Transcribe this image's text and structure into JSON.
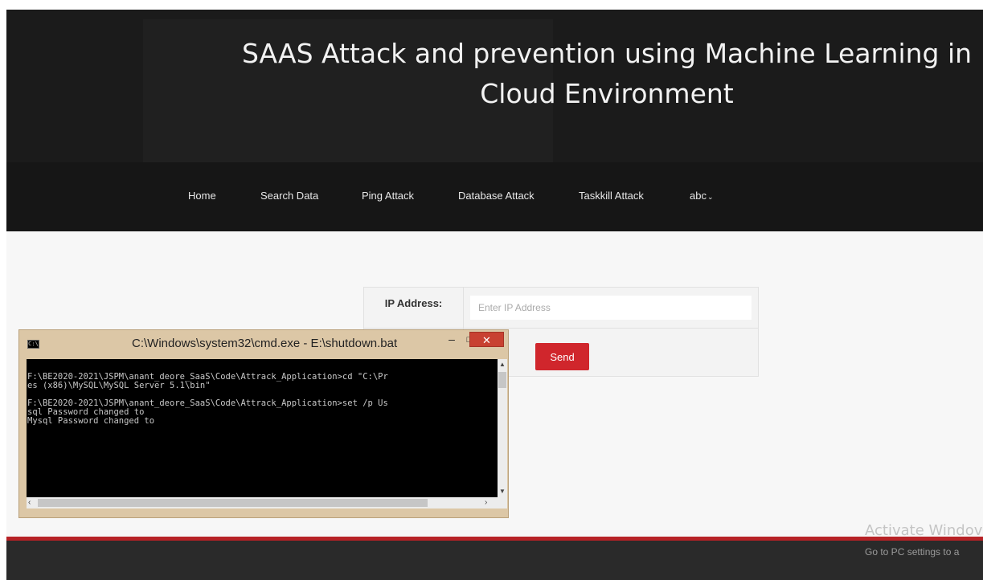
{
  "header": {
    "title": "SAAS Attack and prevention using Machine Learning in Cloud Environment"
  },
  "nav": {
    "items": [
      {
        "label": "Home"
      },
      {
        "label": "Search Data"
      },
      {
        "label": "Ping Attack"
      },
      {
        "label": "Database Attack"
      },
      {
        "label": "Taskkill Attack"
      },
      {
        "label": "abc"
      }
    ],
    "dropdown_icon": "chevron-down-icon"
  },
  "form": {
    "ip_label": "IP Address:",
    "ip_placeholder": "Enter IP Address",
    "send_label": "Send"
  },
  "cmd_window": {
    "title": "C:\\Windows\\system32\\cmd.exe - E:\\shutdown.bat",
    "lines": [
      "F:\\BE2020-2021\\JSPM\\anant_deore_SaaS\\Code\\Attrack_Application>cd \"C:\\Pr",
      "es (x86)\\MySQL\\MySQL Server 5.1\\bin\"",
      "",
      "F:\\BE2020-2021\\JSPM\\anant_deore_SaaS\\Code\\Attrack_Application>set /p Us",
      "sql Password changed to",
      "Mysql Password changed to"
    ]
  },
  "watermark": {
    "line1": "Activate Windov",
    "line2": "Go to PC settings to a"
  },
  "colors": {
    "header_bg": "#1b1b1b",
    "nav_bg": "#161616",
    "accent_red": "#d0262c",
    "cmd_frame": "#dcc7a6"
  }
}
